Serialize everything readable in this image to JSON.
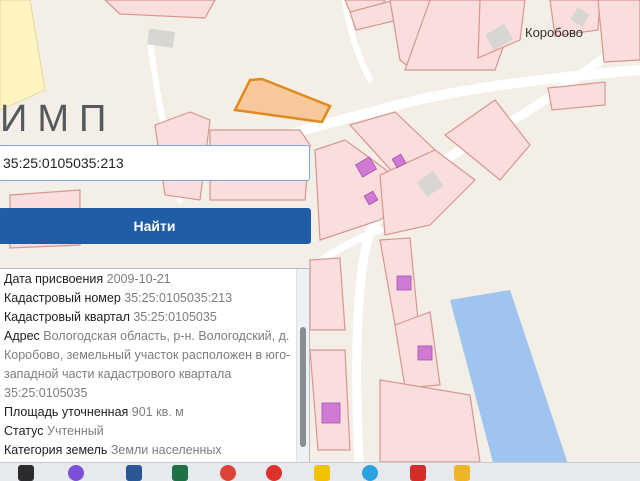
{
  "app": {
    "logo_text": "ИМП"
  },
  "map": {
    "locality_label": "Коробово",
    "colors": {
      "background": "#f4efe6",
      "parcel_fill": "#f9dedd",
      "parcel_stroke": "#d7968f",
      "selected_parcel_fill": "#f7c89b",
      "selected_parcel_stroke": "#e08a1e",
      "building_fill": "#d07bd3",
      "water_fill": "#9ec4ef",
      "road": "#ffffff"
    }
  },
  "search": {
    "value": "35:25:0105035:213"
  },
  "find_button": {
    "label": "Найти"
  },
  "info": {
    "rows": [
      {
        "label": "Дата присвоения",
        "value": "2009-10-21"
      },
      {
        "label": "Кадастровый номер",
        "value": "35:25:0105035:213"
      },
      {
        "label": "Кадастровый квартал",
        "value": "35:25:0105035"
      },
      {
        "label": "Адрес",
        "value": "Вологодская область, р-н. Вологодский, д. Коробово, земельный участок расположен в юго-западной части кадастрового квартала 35:25:0105035"
      },
      {
        "label": "Площадь уточненная",
        "value": "901 кв. м"
      },
      {
        "label": "Статус",
        "value": "Учтенный"
      },
      {
        "label": "Категория земель",
        "value": "Земли населенных"
      }
    ]
  },
  "taskbar": {
    "icons": [
      {
        "name": "start-icon",
        "color": "#2b2b2b"
      },
      {
        "name": "app-icon",
        "color": "#7b4fd6"
      },
      {
        "name": "word-icon",
        "color": "#2b5797"
      },
      {
        "name": "excel-icon",
        "color": "#1e7145"
      },
      {
        "name": "chrome-icon",
        "color": "#db4437"
      },
      {
        "name": "yandex-icon",
        "color": "#e0302a"
      },
      {
        "name": "mail-icon",
        "color": "#f2c200"
      },
      {
        "name": "telegram-icon",
        "color": "#2aa3df"
      },
      {
        "name": "close-app-icon",
        "color": "#d42b2b"
      },
      {
        "name": "folder-icon",
        "color": "#f0b429"
      }
    ]
  }
}
